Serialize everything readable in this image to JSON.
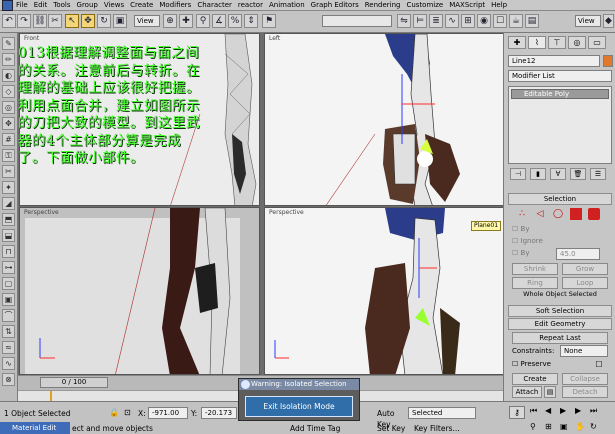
{
  "menu": {
    "items": [
      "File",
      "Edit",
      "Tools",
      "Group",
      "Views",
      "Create",
      "Modifiers",
      "Character",
      "reactor",
      "Animation",
      "Graph Editors",
      "Rendering",
      "Customize",
      "MAXScript",
      "Help"
    ]
  },
  "toolbar": {
    "view_dropdown": "View",
    "view_dropdown_right": "View"
  },
  "viewports": {
    "front": "Front",
    "left": "Left",
    "perspective_left": "Perspective",
    "perspective_right": "Perspective",
    "object_tag": "Plane01"
  },
  "annotation": {
    "text": "013根据理解调整面与面之间的关系。注意前后与转折。在理解的基础上应该很好把握。利用点面合并，建立如图所示的刀把大致的模型。到这里武器的4个主体部分算是完成了。下面做小部件。"
  },
  "command_panel": {
    "object_name": "Line12",
    "modifier_list": "Modifier List",
    "stack_item": "Editable Poly",
    "selection_rollout": "Selection",
    "by_vertex": "By",
    "ignore_backfacing": "Ignore",
    "by_angle": "By",
    "angle_value": "45.0",
    "shrink": "Shrink",
    "grow": "Grow",
    "ring": "Ring",
    "loop": "Loop",
    "whole_object": "Whole Object Selected",
    "soft_selection": "Soft Selection",
    "edit_geometry": "Edit Geometry",
    "repeat_last": "Repeat Last",
    "constraints_label": "Constraints:",
    "constraints_value": "None",
    "preserve": "Preserve",
    "create": "Create",
    "collapse": "Collapse",
    "attach": "Attach",
    "detach": "Detach"
  },
  "trackbar": {
    "frame": "0 / 100"
  },
  "status": {
    "selected_count": "1 Object Selected",
    "prompt": "ect and move objects",
    "x_label": "X:",
    "x_value": "-971.00",
    "y_label": "Y:",
    "y_value": "-20.173",
    "add_time_tag": "Add Time Tag",
    "auto_key": "Auto Key",
    "set_key": "Set Key",
    "selected_dropdown": "Selected",
    "key_filters": "Key Filters...",
    "taskbar_item": "Material Edit"
  },
  "dialog": {
    "title": "Warning: Isolated Selection",
    "button": "Exit Isolation Mode"
  },
  "colors": {
    "annotation_green": "#45ff2a",
    "dialog_button": "#2f6ea8",
    "active_tool": "#f3d57a"
  }
}
